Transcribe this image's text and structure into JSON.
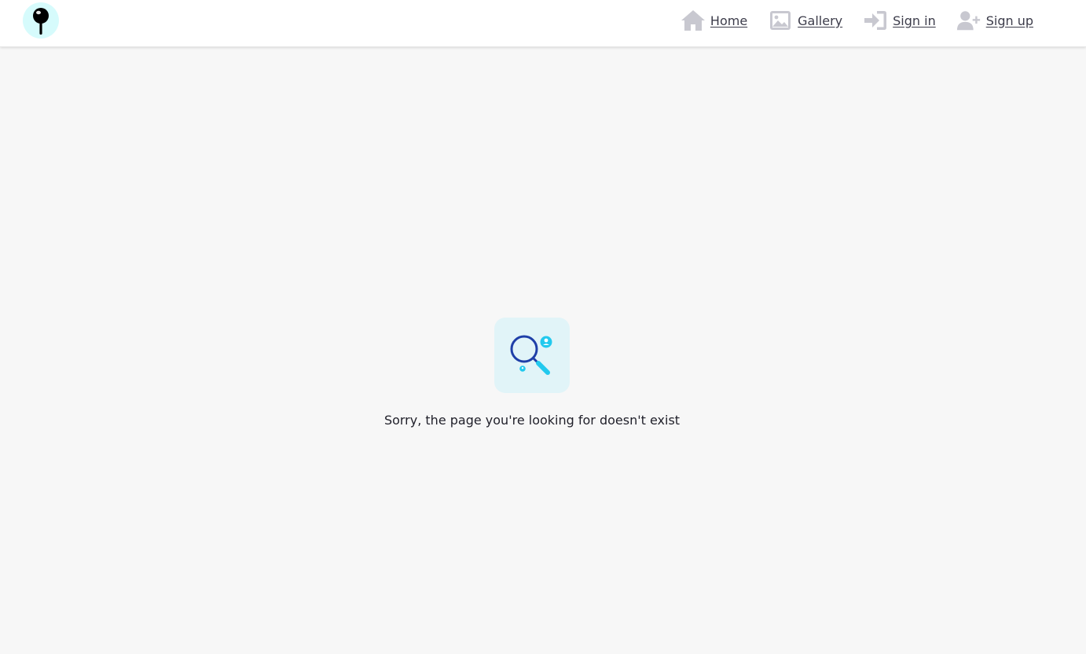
{
  "header": {
    "logo_icon": "pin-icon",
    "nav": [
      {
        "label": "Home",
        "icon": "home-icon"
      },
      {
        "label": "Gallery",
        "icon": "image-icon"
      },
      {
        "label": "Sign in",
        "icon": "sign-in-icon"
      },
      {
        "label": "Sign up",
        "icon": "user-plus-icon"
      }
    ]
  },
  "main": {
    "illustration_icon": "magnifier-search-icon",
    "message": "Sorry, the page you're looking for doesn't exist"
  },
  "colors": {
    "background": "#f7f7f7",
    "header_bg": "#ffffff",
    "logo_bg": "#d6fbfc",
    "nav_icon": "#c8c8d0",
    "nav_text": "#3c3c4a",
    "illustration_bg": "#e1f4f8",
    "magnifier_ring": "#1f3fa8",
    "accent_cyan": "#22c9ee"
  }
}
